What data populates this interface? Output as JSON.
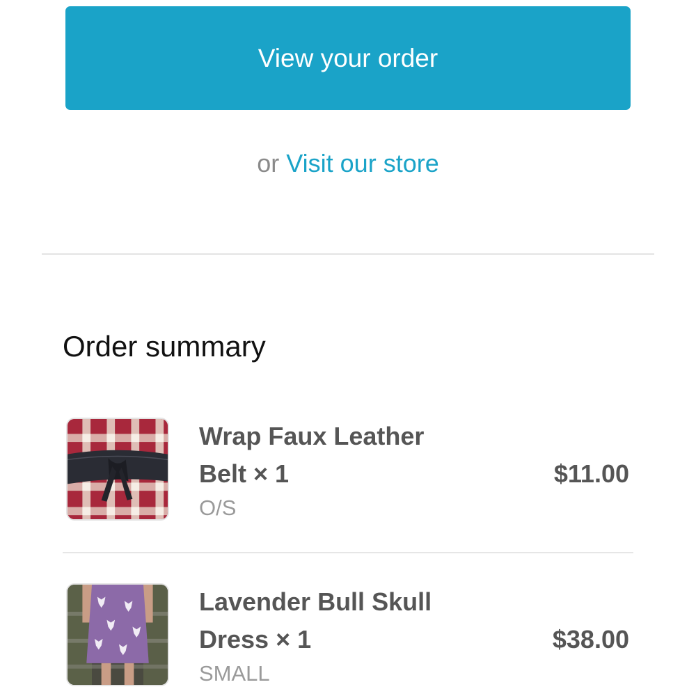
{
  "actions": {
    "view_order_label": "View your order",
    "or_text": "or",
    "visit_store_label": "Visit our store"
  },
  "summary": {
    "title": "Order summary",
    "items": [
      {
        "name_line1": "Wrap Faux Leather",
        "name_line2": "Belt × 1",
        "variant": "O/S",
        "price": "$11.00",
        "image_icon": "belt-product-image"
      },
      {
        "name_line1": "Lavender Bull Skull",
        "name_line2": "Dress × 1",
        "variant": "SMALL",
        "price": "$38.00",
        "image_icon": "dress-product-image"
      }
    ]
  },
  "colors": {
    "accent": "#1aa3c8",
    "text_primary": "#555555",
    "text_muted": "#9a9a9a",
    "divider": "#e3e3e3"
  }
}
